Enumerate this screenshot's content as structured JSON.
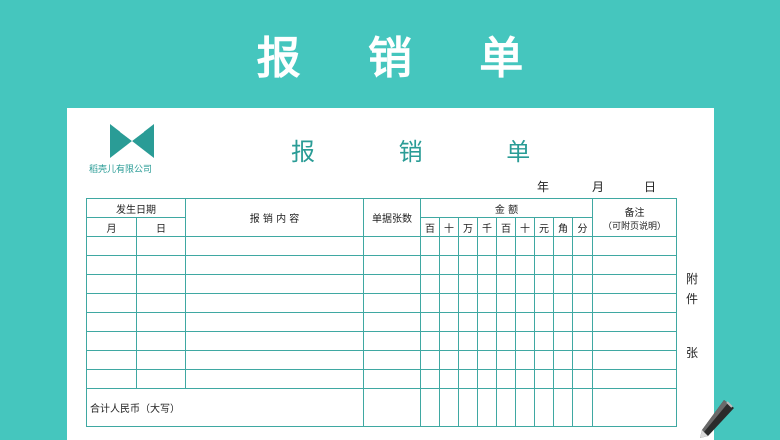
{
  "banner": {
    "title": "报 销 单"
  },
  "form": {
    "title": "报 销 单",
    "logo_text": "稻壳儿有限公司",
    "date": {
      "year": "年",
      "month": "月",
      "day": "日"
    },
    "headers": {
      "send_date": "发生日期",
      "month": "月",
      "day": "日",
      "content": "报 销 内 容",
      "doc_count": "单据张数",
      "amount": "金 额",
      "digits": [
        "百",
        "十",
        "万",
        "千",
        "百",
        "十",
        "元",
        "角",
        "分"
      ],
      "note": "备注",
      "note_sub": "（可附页说明）"
    },
    "row_count": 8,
    "total_label": "合计人民币（大写）"
  },
  "side": {
    "attach": "附",
    "item": "件",
    "sheet": "张"
  },
  "colors": {
    "background": "#45c6be",
    "accent": "#2a9c96",
    "line": "#3fa8a2"
  },
  "icons": {
    "logo": "company-logo-icon",
    "pen": "pen-icon"
  }
}
